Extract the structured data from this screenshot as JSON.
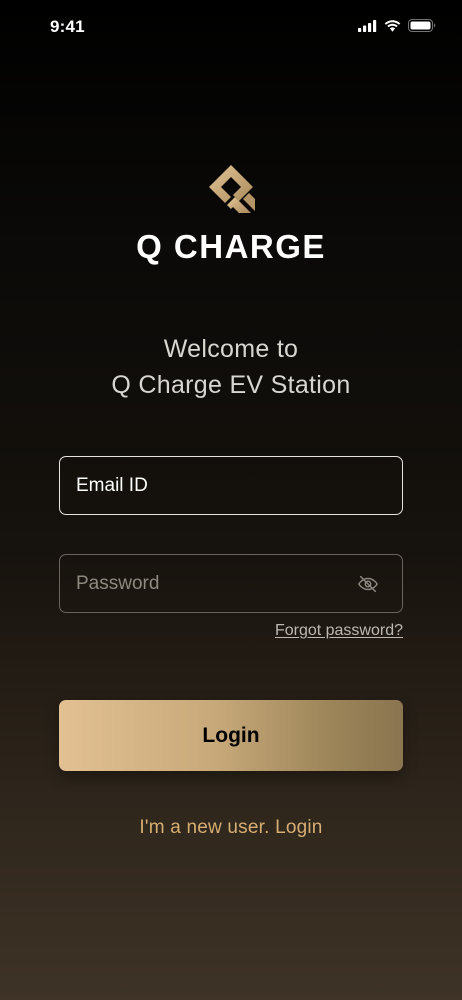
{
  "status_bar": {
    "time": "9:41",
    "icons": [
      "cellular-signal-icon",
      "wifi-icon",
      "battery-icon"
    ]
  },
  "brand": {
    "name": "Q CHARGE",
    "logo_icon": "q-charge-logo-icon",
    "accent_color": "#c9a36e"
  },
  "welcome": {
    "line1": "Welcome to",
    "line2": "Q Charge EV Station"
  },
  "form": {
    "email_placeholder": "Email ID",
    "email_value": "",
    "password_placeholder": "Password",
    "password_value": "",
    "password_toggle_icon": "eye-off-icon",
    "forgot_password": "Forgot password?",
    "login_label": "Login"
  },
  "signup": {
    "text": "I'm a new user. Login"
  }
}
